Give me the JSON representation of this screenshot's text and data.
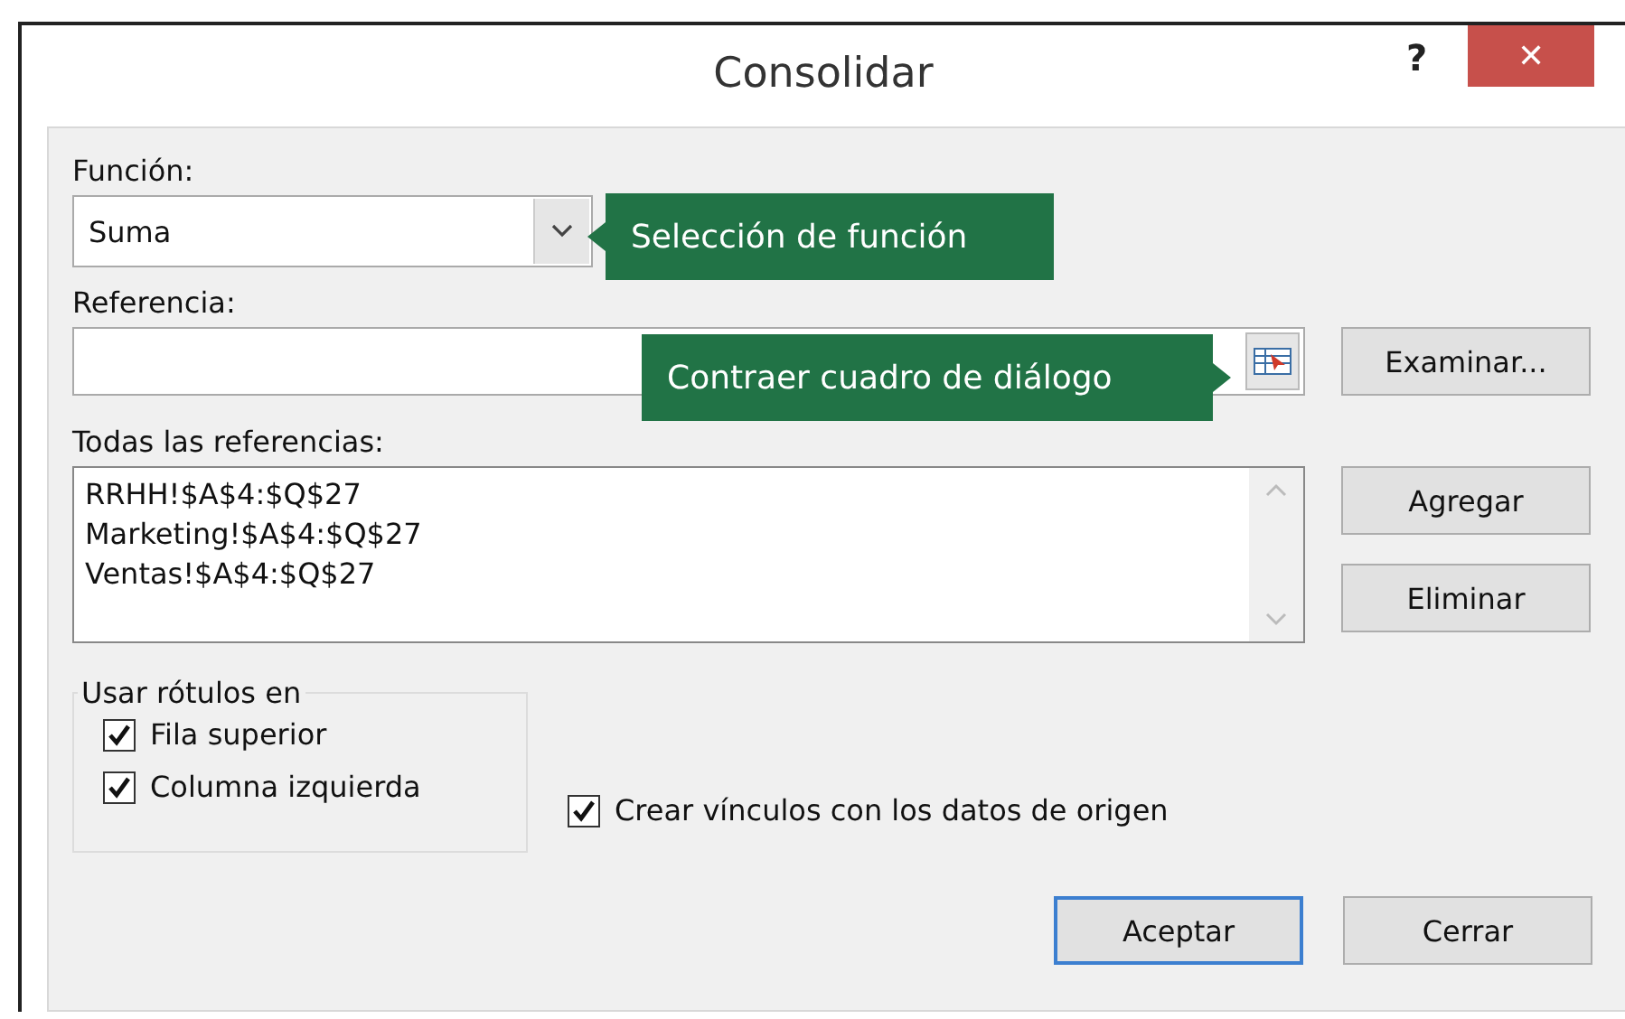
{
  "window": {
    "title": "Consolidar",
    "help": "?",
    "close": "✕"
  },
  "function_field": {
    "label": "Función:",
    "value": "Suma"
  },
  "reference_field": {
    "label": "Referencia:"
  },
  "browse_button": "Examinar...",
  "all_references": {
    "label": "Todas las referencias:",
    "items": [
      {
        "text": "RRHH!$A$4:$Q$27",
        "selected": false
      },
      {
        "text": "Marketing!$A$4:$Q$27",
        "selected": false
      },
      {
        "text": "Ventas!$A$4:$Q$27",
        "selected": false
      }
    ]
  },
  "side_buttons": [
    "Agregar",
    "Eliminar"
  ],
  "labels_group": {
    "title": "Usar rótulos en",
    "options": [
      {
        "label": "Fila superior",
        "checked": true
      },
      {
        "label": "Columna izquierda",
        "checked": true
      }
    ]
  },
  "link_option": {
    "label": "Crear vínculos con los datos de origen",
    "checked": true
  },
  "buttons": [
    {
      "label": "Aceptar",
      "default": true
    },
    {
      "label": "Cerrar",
      "default": false
    }
  ],
  "callouts": [
    {
      "text": "Selección de función",
      "kind": "pointer-left"
    },
    {
      "text": "Contraer cuadro de diálogo",
      "kind": "pointer-right"
    }
  ]
}
